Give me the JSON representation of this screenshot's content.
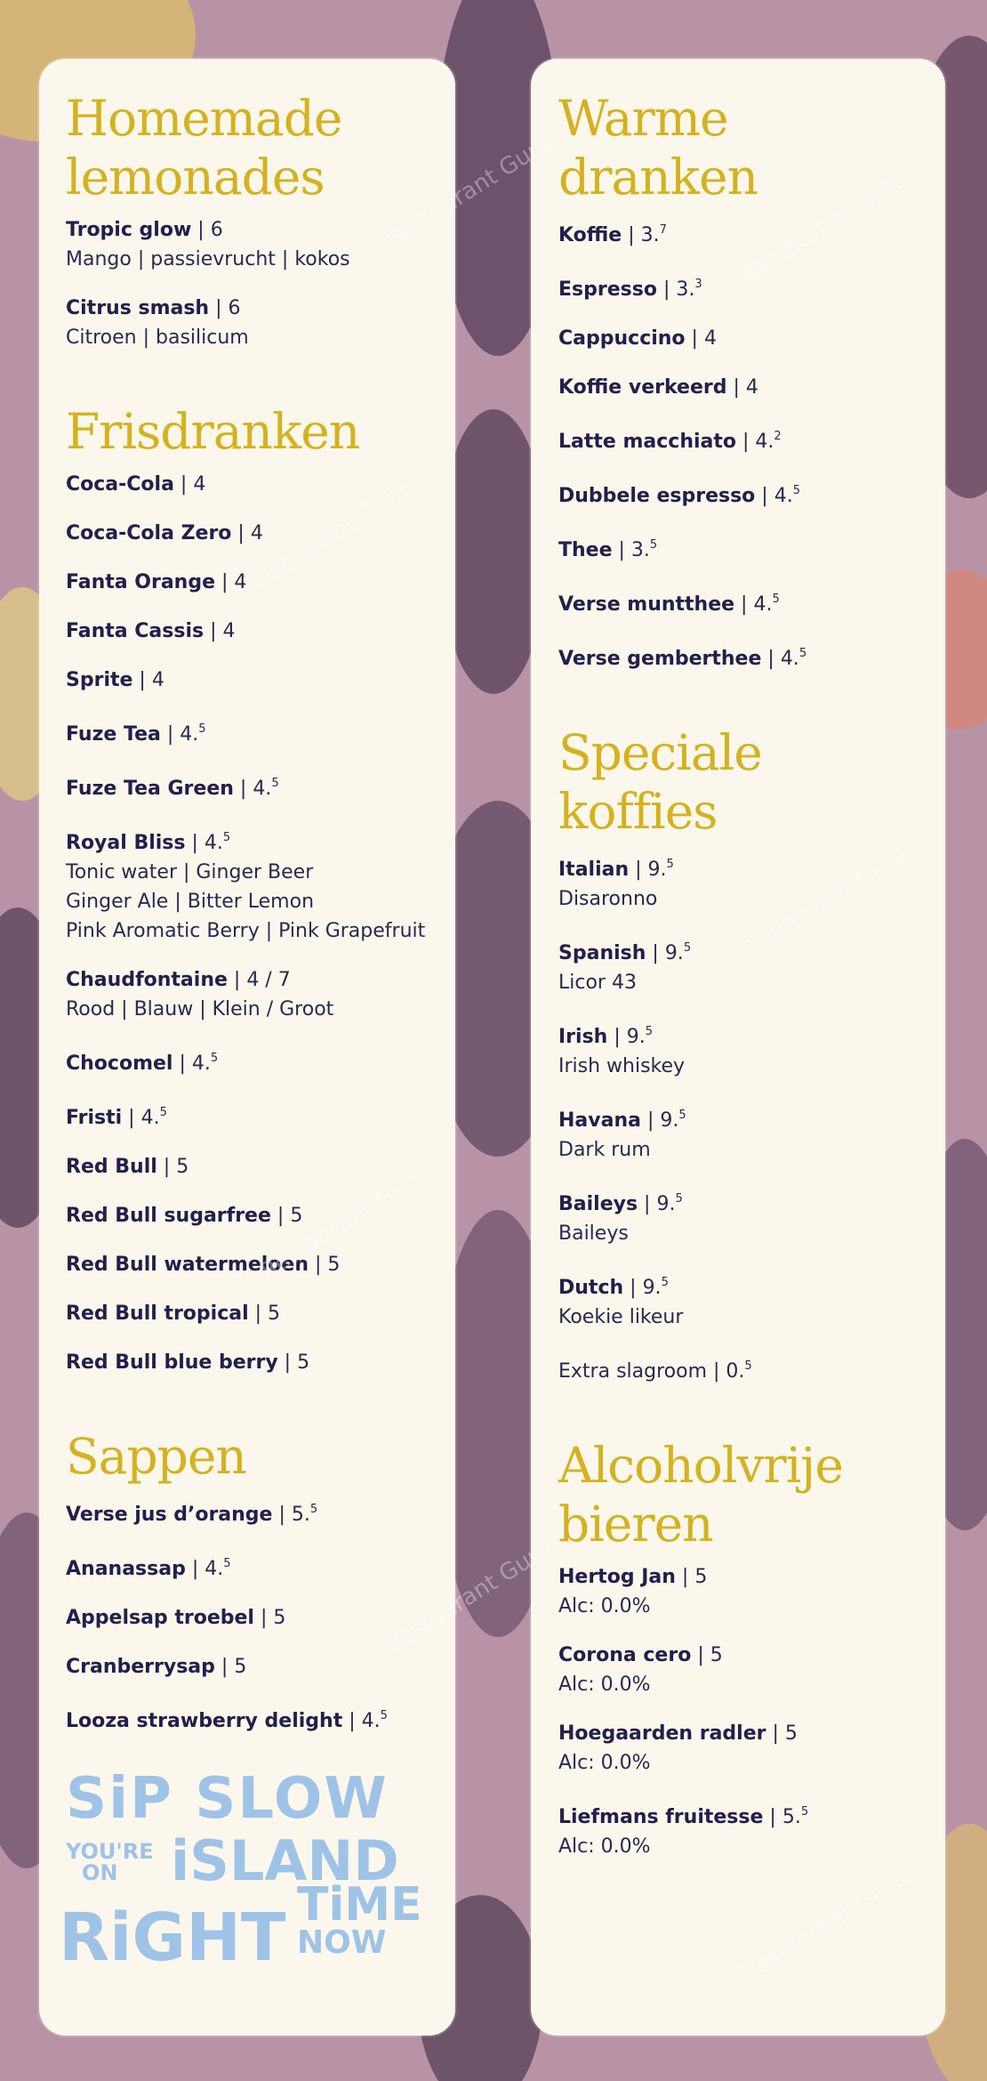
{
  "left": {
    "homemade": {
      "heading_1": "Homemade",
      "heading_2": "lemonades",
      "items": [
        {
          "name": "Tropic glow",
          "price": "6",
          "sup": "",
          "desc": "Mango | passievrucht | kokos"
        },
        {
          "name": "Citrus smash",
          "price": "6",
          "sup": "",
          "desc": "Citroen | basilicum"
        }
      ]
    },
    "frisdranken": {
      "heading": "Frisdranken",
      "items": [
        {
          "name": "Coca-Cola",
          "price": "4",
          "sup": ""
        },
        {
          "name": "Coca-Cola Zero",
          "price": "4",
          "sup": ""
        },
        {
          "name": "Fanta Orange",
          "price": "4",
          "sup": ""
        },
        {
          "name": "Fanta Cassis",
          "price": "4",
          "sup": ""
        },
        {
          "name": "Sprite",
          "price": "4",
          "sup": ""
        },
        {
          "name": "Fuze Tea",
          "price": "4.",
          "sup": "5"
        },
        {
          "name": "Fuze Tea Green",
          "price": "4.",
          "sup": "5"
        },
        {
          "name": "Royal Bliss",
          "price": "4.",
          "sup": "5",
          "desc_lines": [
            "Tonic water | Ginger Beer",
            "Ginger Ale | Bitter Lemon",
            "Pink Aromatic Berry | Pink Grapefruit"
          ]
        },
        {
          "name": "Chaudfontaine",
          "price": "4 / 7",
          "sup": "",
          "desc_lines": [
            "Rood | Blauw | Klein / Groot"
          ]
        },
        {
          "name": "Chocomel",
          "price": "4.",
          "sup": "5"
        },
        {
          "name": "Fristi",
          "price": "4.",
          "sup": "5"
        },
        {
          "name": "Red Bull",
          "price": "5",
          "sup": ""
        },
        {
          "name": "Red Bull sugarfree",
          "price": "5",
          "sup": ""
        },
        {
          "name": "Red Bull watermeloen",
          "price": "5",
          "sup": ""
        },
        {
          "name": "Red Bull tropical",
          "price": "5",
          "sup": ""
        },
        {
          "name": "Red Bull blue berry",
          "price": "5",
          "sup": ""
        }
      ]
    },
    "sappen": {
      "heading": "Sappen",
      "items": [
        {
          "name": "Verse jus d’orange",
          "price": "5.",
          "sup": "5"
        },
        {
          "name": "Ananassap",
          "price": "4.",
          "sup": "5"
        },
        {
          "name": "Appelsap troebel",
          "price": "5",
          "sup": ""
        },
        {
          "name": "Cranberrysap",
          "price": "5",
          "sup": ""
        },
        {
          "name": "Looza strawberry delight",
          "price": "4.",
          "sup": "5"
        }
      ]
    },
    "slogan": {
      "line1": "SiP SLOW",
      "youre": "YOU'RE",
      "on": "ON",
      "island": "iSLAND",
      "time": "TiME",
      "right": "RiGHT",
      "now": "NOW"
    }
  },
  "right": {
    "warme": {
      "heading_1": "Warme",
      "heading_2": "dranken",
      "items": [
        {
          "name": "Koffie",
          "price": "3.",
          "sup": "7"
        },
        {
          "name": "Espresso",
          "price": "3.",
          "sup": "3"
        },
        {
          "name": "Cappuccino",
          "price": "4",
          "sup": ""
        },
        {
          "name": "Koffie verkeerd",
          "price": "4",
          "sup": ""
        },
        {
          "name": "Latte macchiato",
          "price": "4.",
          "sup": "2"
        },
        {
          "name": "Dubbele espresso",
          "price": "4.",
          "sup": "5"
        },
        {
          "name": "Thee",
          "price": "3.",
          "sup": "5"
        },
        {
          "name": "Verse muntthee",
          "price": "4.",
          "sup": "5"
        },
        {
          "name": "Verse gemberthee",
          "price": "4.",
          "sup": "5"
        }
      ]
    },
    "speciale": {
      "heading_1": "Speciale",
      "heading_2": "koffies",
      "items": [
        {
          "name": "Italian",
          "price": "9.",
          "sup": "5",
          "desc": "Disaronno"
        },
        {
          "name": "Spanish",
          "price": "9.",
          "sup": "5",
          "desc": "Licor 43"
        },
        {
          "name": "Irish",
          "price": "9.",
          "sup": "5",
          "desc": "Irish whiskey"
        },
        {
          "name": "Havana",
          "price": "9.",
          "sup": "5",
          "desc": "Dark rum"
        },
        {
          "name": "Baileys",
          "price": "9.",
          "sup": "5",
          "desc": "Baileys"
        },
        {
          "name": "Dutch",
          "price": "9.",
          "sup": "5",
          "desc": "Koekie likeur"
        }
      ],
      "extra": {
        "label": "Extra slagroom",
        "price": "0.",
        "sup": "5"
      }
    },
    "alcoholvrij": {
      "heading_1": "Alcoholvrije",
      "heading_2": "bieren",
      "items": [
        {
          "name": "Hertog Jan",
          "price": "5",
          "sup": "",
          "desc": "Alc: 0.0%"
        },
        {
          "name": "Corona cero",
          "price": "5",
          "sup": "",
          "desc": "Alc: 0.0%"
        },
        {
          "name": "Hoegaarden radler",
          "price": "5",
          "sup": "",
          "desc": "Alc: 0.0%"
        },
        {
          "name": "Liefmans fruitesse",
          "price": "5.",
          "sup": "5",
          "desc": "Alc: 0.0%"
        }
      ]
    }
  },
  "watermark": "Restaurant Guru",
  "colors": {
    "heading": "#d4b21f",
    "text": "#221f4a",
    "slogan": "#9fc3e6",
    "panel": "#fbf7ec"
  }
}
